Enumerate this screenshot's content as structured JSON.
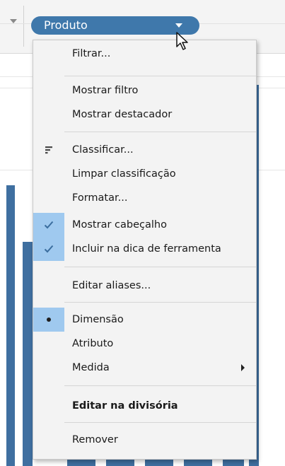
{
  "shelf": {
    "pill_label": "Produto",
    "pill_color": "#3f78ab"
  },
  "menu": {
    "items": [
      {
        "id": "filtrar",
        "label": "Filtrar..."
      },
      {
        "id": "mostrar-filtro",
        "label": "Mostrar filtro"
      },
      {
        "id": "mostrar-destacador",
        "label": "Mostrar destacador"
      },
      {
        "id": "classificar",
        "label": "Classificar...",
        "icon": "sort-icon"
      },
      {
        "id": "limpar-classificacao",
        "label": "Limpar classificação"
      },
      {
        "id": "formatar",
        "label": "Formatar..."
      },
      {
        "id": "mostrar-cabecalho",
        "label": "Mostrar cabeçalho",
        "checked": true,
        "icon": "check-icon"
      },
      {
        "id": "incluir-dica",
        "label": "Incluir na dica de ferramenta",
        "checked": true,
        "icon": "check-icon"
      },
      {
        "id": "editar-aliases",
        "label": "Editar aliases..."
      },
      {
        "id": "dimensao",
        "label": "Dimensão",
        "selected": true,
        "icon": "bullet-icon"
      },
      {
        "id": "atributo",
        "label": "Atributo"
      },
      {
        "id": "medida",
        "label": "Medida",
        "submenu": true,
        "icon": "chevron-right-icon"
      },
      {
        "id": "editar-divisoria",
        "label": "Editar na divisória",
        "bold": true
      },
      {
        "id": "remover",
        "label": "Remover"
      }
    ],
    "highlight_color": "#9fc9ef"
  },
  "colors": {
    "bar": "#3f6fa0",
    "menu_bg": "#f3f3f3"
  }
}
